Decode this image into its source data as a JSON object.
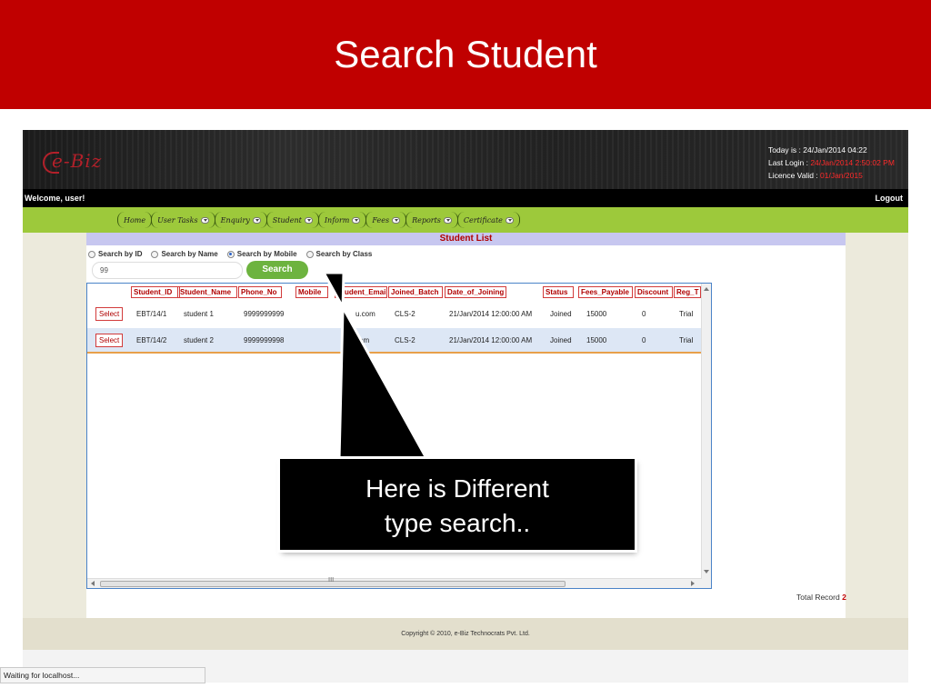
{
  "slide": {
    "title": "Search Student"
  },
  "app": {
    "logo_text": "e-Biz",
    "header_info": {
      "today_label": "Today is : ",
      "today_value": "24/Jan/2014 04:22",
      "last_login_label": "Last Login : ",
      "last_login_value": "24/Jan/2014 2:50:02 PM",
      "licence_label": "Licence Valid : ",
      "licence_value": "01/Jan/2015"
    },
    "welcome": "Welcome,  user!",
    "logout": "Logout",
    "nav": [
      {
        "label": "Home",
        "dropdown": false
      },
      {
        "label": "User Tasks",
        "dropdown": true
      },
      {
        "label": "Enquiry",
        "dropdown": true
      },
      {
        "label": "Student",
        "dropdown": true
      },
      {
        "label": "Inform",
        "dropdown": true
      },
      {
        "label": "Fees",
        "dropdown": true
      },
      {
        "label": "Reports",
        "dropdown": true
      },
      {
        "label": "Certificate",
        "dropdown": true
      }
    ],
    "list_title": "Student List",
    "search_options": [
      {
        "label": "Search by ID",
        "selected": false
      },
      {
        "label": "Search by Name",
        "selected": false
      },
      {
        "label": "Search by Mobile",
        "selected": true
      },
      {
        "label": "Search by Class",
        "selected": false
      }
    ],
    "search_value": "99",
    "search_button": "Search",
    "columns": [
      "Student_ID",
      "Student_Name",
      "Phone_No",
      "Mobile",
      "Student_Email",
      "Joined_Batch",
      "Date_of_Joining",
      "Status",
      "Fees_Payable",
      "Discount",
      "Reg_T"
    ],
    "select_label": "Select",
    "rows": [
      {
        "student_id": "EBT/14/1",
        "student_name": "student 1",
        "phone_no": "9999999999",
        "email": "u.com",
        "batch": "CLS-2",
        "date": "21/Jan/2014 12:00:00 AM",
        "status": "Joined",
        "fees": "15000",
        "discount": "0",
        "reg": "Trial"
      },
      {
        "student_id": "EBT/14/2",
        "student_name": "student 2",
        "phone_no": "9999999998",
        "email": "com",
        "batch": "CLS-2",
        "date": "21/Jan/2014 12:00:00 AM",
        "status": "Joined",
        "fees": "15000",
        "discount": "0",
        "reg": "Trial"
      }
    ],
    "total_label": "Total Record",
    "total_value": "2",
    "footer": "Copyright © 2010, e-Biz Technocrats Pvt. Ltd.",
    "browser_status": "Waiting for localhost..."
  },
  "callout": {
    "line1": "Here is Different",
    "line2": "type search.."
  },
  "colors": {
    "title_bar": "#c00000",
    "nav_bar": "#9dc93b",
    "accent_red": "#b00000",
    "search_green": "#6db33f",
    "grid_border": "#4a83c8"
  }
}
